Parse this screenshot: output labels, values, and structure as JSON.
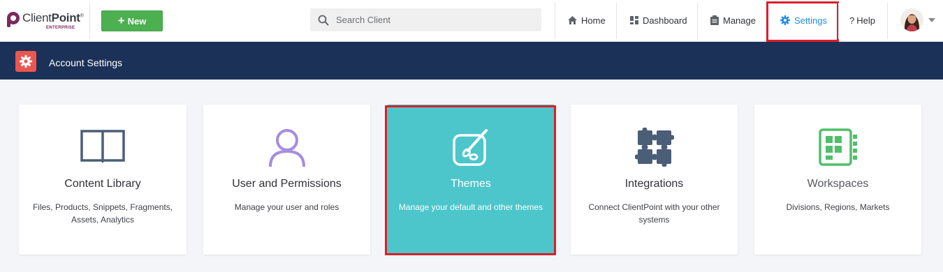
{
  "brand": {
    "name_regular": "Client",
    "name_bold": "Point",
    "trademark": "®",
    "edition": "ENTERPRISE"
  },
  "header": {
    "new_button_label": "New",
    "search_placeholder": "Search Client",
    "nav": {
      "home": "Home",
      "dashboard": "Dashboard",
      "manage": "Manage",
      "settings": "Settings",
      "help": "Help"
    }
  },
  "account_bar": {
    "title": "Account Settings"
  },
  "cards": [
    {
      "title": "Content Library",
      "desc": "Files, Products, Snippets, Fragments, Assets, Analytics",
      "icon": "book-icon"
    },
    {
      "title": "User and Permissions",
      "desc": "Manage your user and roles",
      "icon": "user-icon"
    },
    {
      "title": "Themes",
      "desc": "Manage your default and other themes",
      "icon": "palette-brush-icon"
    },
    {
      "title": "Integrations",
      "desc": "Connect ClientPoint with your other systems",
      "icon": "puzzle-icon"
    },
    {
      "title": "Workspaces",
      "desc": "Divisions, Regions, Markets",
      "icon": "workspace-icon"
    }
  ],
  "colors": {
    "accent_blue": "#1e8ce8",
    "new_button": "#4caf50",
    "header_bar": "#1b3158",
    "themes_card": "#4cc6cb",
    "highlight": "#d9202a"
  }
}
